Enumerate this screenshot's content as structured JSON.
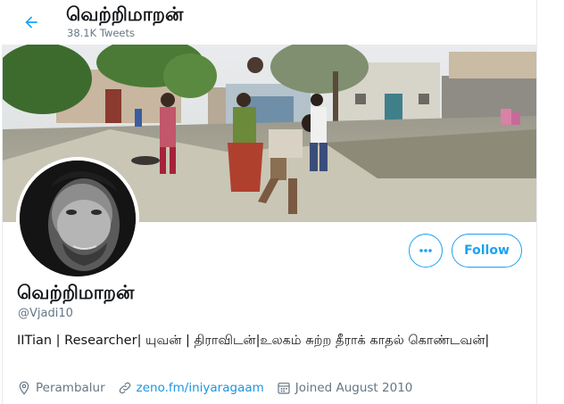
{
  "header": {
    "title": "வெற்றிமாறன்",
    "tweet_count": "38.1K Tweets",
    "back_icon": "arrow-left-icon"
  },
  "banner": {
    "description_icon": "banner-photo"
  },
  "profile": {
    "name": "வெற்றிமாறன்",
    "handle": "@Vjadi10",
    "bio": "IITian | Researcher| யுவன் | திராவிடன்|உலகம் சுற்ற தீராக் காதல் கொண்டவன்|",
    "location": "Perambalur",
    "website": "zeno.fm/iniyaragaam",
    "joined": "Joined August 2010"
  },
  "actions": {
    "more_label": "More",
    "follow_label": "Follow"
  },
  "colors": {
    "accent": "#1da1f2",
    "link": "#1b95e0",
    "secondary_text": "#657786"
  }
}
